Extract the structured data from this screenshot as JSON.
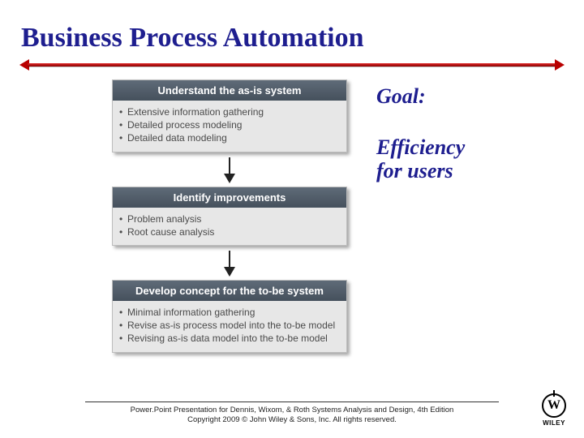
{
  "title": "Business Process Automation",
  "blocks": [
    {
      "header": "Understand the as-is system",
      "items": [
        "Extensive information gathering",
        "Detailed process modeling",
        "Detailed data modeling"
      ]
    },
    {
      "header": "Identify improvements",
      "items": [
        "Problem analysis",
        "Root cause analysis"
      ]
    },
    {
      "header": "Develop concept for the to-be system",
      "items": [
        "Minimal information gathering",
        "Revise as-is process model into the to-be model",
        "Revising as-is data model into the to-be model"
      ]
    }
  ],
  "right": {
    "goal": "Goal:",
    "eff_line1": "Efficiency",
    "eff_line2": "for users"
  },
  "footer": {
    "line1": "Power.Point Presentation for Dennis, Wixom, & Roth Systems Analysis and Design, 4th Edition",
    "line2": "Copyright 2009 © John Wiley & Sons, Inc. All rights reserved."
  },
  "logo": {
    "mark": "W",
    "word": "WILEY"
  }
}
